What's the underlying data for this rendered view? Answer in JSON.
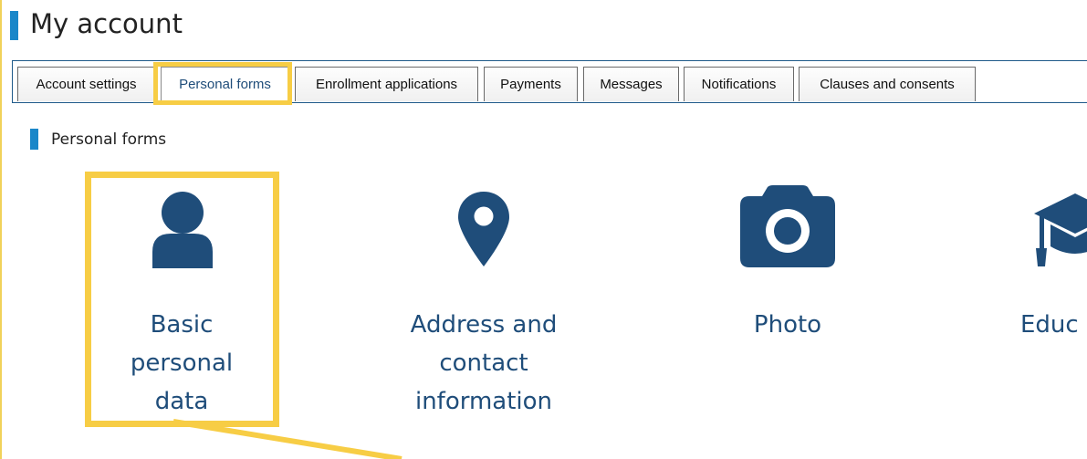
{
  "page": {
    "title": "My account"
  },
  "tabs": [
    {
      "label": "Account settings"
    },
    {
      "label": "Personal forms"
    },
    {
      "label": "Enrollment applications"
    },
    {
      "label": "Payments"
    },
    {
      "label": "Messages"
    },
    {
      "label": "Notifications"
    },
    {
      "label": "Clauses and consents"
    }
  ],
  "active_tab": "Personal forms",
  "section": {
    "title": "Personal forms"
  },
  "cards": [
    {
      "label": "Basic personal data",
      "icon": "user-icon"
    },
    {
      "label": "Address and contact information",
      "icon": "map-pin-icon"
    },
    {
      "label": "Photo",
      "icon": "camera-icon"
    },
    {
      "label": "Educ",
      "icon": "graduation-cap-icon"
    }
  ],
  "colors": {
    "accent_blue": "#1a87c9",
    "icon_navy": "#1f4d7a",
    "highlight_yellow": "#f7cd45"
  }
}
